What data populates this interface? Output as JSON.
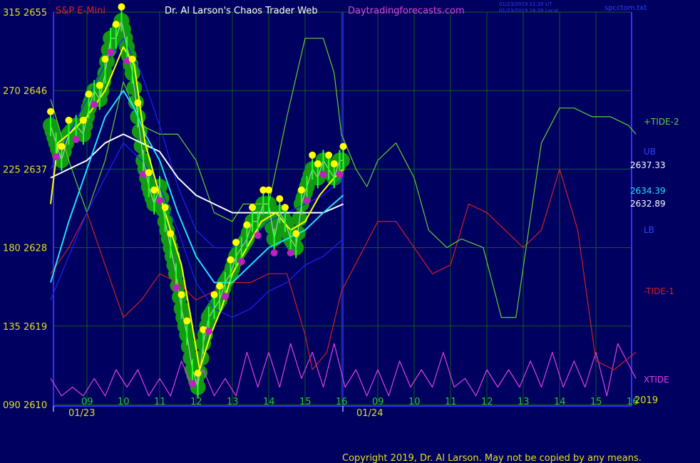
{
  "header": {
    "instrument": "S&P E-Mini",
    "title": "Dr. Al Larson's Chaos Trader Web",
    "site": "Daytradingforecasts.com",
    "stamp1": "01/23/2019 21:20 UT",
    "stamp2": "01/23/2019 16:20 Local",
    "file": "spcctom.txt"
  },
  "footer": {
    "copyright": "Copyright 2019, Dr. Al Larson. May not be copied by any means."
  },
  "colors": {
    "background": "#000060",
    "grid": "#0c5c22",
    "axis": "#3030ff",
    "price_bars": "#22ff22",
    "green_blob": "#139a13",
    "yellow_dot": "#ffff00",
    "magenta_dot": "#c020c0",
    "yellow_line": "#ffff00",
    "cyan_line": "#20e0ff",
    "white_line": "#ffffff",
    "blue_line": "#2020ff",
    "tide2": "#60d030",
    "tide1": "#d02020",
    "xtide": "#e040e0"
  },
  "chart_data": {
    "type": "line",
    "y_left_labels": [
      "315",
      "270",
      "225",
      "180",
      "135",
      "090"
    ],
    "y_right_labels": [
      "2655",
      "2646",
      "2637",
      "2628",
      "2619",
      "2610"
    ],
    "x_ticks_day1": [
      "09",
      "10",
      "11",
      "12",
      "13",
      "14",
      "15",
      "16"
    ],
    "x_ticks_day2": [
      "09",
      "10",
      "11",
      "12",
      "13",
      "14",
      "15",
      "16"
    ],
    "date1": "01/23",
    "date2": "01/24",
    "year": "2019",
    "ylim": [
      2610,
      2655
    ],
    "xlim": [
      8,
      17
    ],
    "legend": [
      {
        "label": "+TIDE-2",
        "color": "#60d030"
      },
      {
        "label": "UB",
        "color": "#2020ff"
      },
      {
        "label": "2637.33",
        "color": "#ffffff"
      },
      {
        "label": "2634.39",
        "color": "#20e0ff"
      },
      {
        "label": "2632.89",
        "color": "#ffffff"
      },
      {
        "label": "LB",
        "color": "#2020ff"
      },
      {
        "label": "-TIDE-1",
        "color": "#d02020"
      },
      {
        "label": "XTIDE",
        "color": "#e040e0"
      }
    ],
    "series": [
      {
        "id": "price",
        "x": [
          8.0,
          8.15,
          8.3,
          8.5,
          8.7,
          8.9,
          9.05,
          9.2,
          9.35,
          9.5,
          9.65,
          9.8,
          9.95,
          10.1,
          10.25,
          10.4,
          10.55,
          10.7,
          10.85,
          11.0,
          11.15,
          11.3,
          11.45,
          11.6,
          11.75,
          11.9,
          12.05,
          12.2,
          12.35,
          12.5,
          12.65,
          12.8,
          12.95,
          13.1,
          13.25,
          13.4,
          13.55,
          13.7,
          13.85,
          14.0,
          14.15,
          14.3,
          14.45,
          14.6,
          14.75,
          14.9,
          15.05,
          15.2,
          15.35,
          15.5,
          15.65,
          15.8,
          15.95,
          16.05
        ],
        "y": [
          2642,
          2640,
          2638,
          2641,
          2642,
          2641,
          2644,
          2646,
          2645,
          2648,
          2652,
          2652,
          2654,
          2651,
          2648,
          2643,
          2638,
          2635,
          2633,
          2635,
          2631,
          2628,
          2625,
          2621,
          2618,
          2614,
          2612,
          2617,
          2620,
          2621,
          2622,
          2624,
          2625,
          2627,
          2628,
          2629,
          2631,
          2631,
          2633,
          2633,
          2629,
          2632,
          2631,
          2629,
          2628,
          2633,
          2635,
          2637,
          2636,
          2638,
          2637,
          2636,
          2638,
          2638
        ]
      },
      {
        "id": "+TIDE-2",
        "x": [
          8.0,
          8.5,
          9.0,
          9.5,
          10.0,
          10.5,
          11.0,
          11.5,
          12.0,
          12.5,
          13.0,
          13.3,
          13.7,
          14.0,
          14.5,
          15.0,
          15.5,
          15.8,
          16.0,
          16.4,
          16.7,
          17.0,
          17.5,
          18.0,
          18.4,
          18.9,
          19.3,
          19.9,
          20.4,
          20.8,
          21.5,
          22.0,
          22.4,
          22.9,
          23.4,
          23.9,
          24.1
        ],
        "y": [
          2645,
          2638,
          2632,
          2638,
          2647,
          2642,
          2641,
          2641,
          2638,
          2632,
          2631,
          2633,
          2633,
          2633,
          2643,
          2652,
          2652,
          2648,
          2641,
          2637,
          2635,
          2638,
          2640,
          2636,
          2630,
          2628,
          2629,
          2628,
          2620,
          2620,
          2640,
          2644,
          2644,
          2643,
          2643,
          2642,
          2641
        ]
      },
      {
        "id": "-TIDE-1",
        "x": [
          8.0,
          8.5,
          9.0,
          9.5,
          10.0,
          10.5,
          11.0,
          11.5,
          12.0,
          12.5,
          13.0,
          13.5,
          14.0,
          14.5,
          15.0,
          15.2,
          15.6,
          16.0,
          16.5,
          17.0,
          17.5,
          18.0,
          18.5,
          19.0,
          19.5,
          20.0,
          20.5,
          21.0,
          21.5,
          22.0,
          22.5,
          23.0,
          23.5,
          24.1
        ],
        "y": [
          2625,
          2628,
          2632,
          2626,
          2620,
          2622,
          2625,
          2624,
          2622,
          2623,
          2624,
          2624,
          2625,
          2625,
          2618,
          2614,
          2616,
          2623,
          2627,
          2631,
          2631,
          2628,
          2625,
          2626,
          2633,
          2632,
          2630,
          2628,
          2630,
          2637,
          2630,
          2615,
          2614,
          2616
        ]
      },
      {
        "id": "XTIDE",
        "x": [
          8.0,
          8.3,
          8.6,
          8.9,
          9.2,
          9.5,
          9.8,
          10.1,
          10.4,
          10.7,
          11.0,
          11.3,
          11.6,
          11.9,
          12.2,
          12.5,
          12.8,
          13.1,
          13.4,
          13.7,
          14.0,
          14.3,
          14.6,
          14.9,
          15.2,
          15.5,
          15.8,
          16.1,
          16.4,
          16.7,
          17.0,
          17.3,
          17.6,
          17.9,
          18.2,
          18.5,
          18.8,
          19.1,
          19.4,
          19.7,
          20.0,
          20.3,
          20.6,
          20.9,
          21.2,
          21.5,
          21.8,
          22.1,
          22.4,
          22.7,
          23.0,
          23.3,
          23.6,
          24.1
        ],
        "y": [
          2613,
          2611,
          2612,
          2611,
          2613,
          2611,
          2614,
          2612,
          2614,
          2611,
          2613,
          2611,
          2615,
          2612,
          2614,
          2611,
          2613,
          2611,
          2616,
          2612,
          2616,
          2612,
          2617,
          2613,
          2616,
          2612,
          2617,
          2612,
          2614,
          2611,
          2614,
          2611,
          2615,
          2612,
          2614,
          2612,
          2616,
          2612,
          2613,
          2611,
          2614,
          2612,
          2614,
          2612,
          2615,
          2612,
          2616,
          2612,
          2615,
          2612,
          2616,
          2611,
          2617,
          2613
        ]
      },
      {
        "id": "yellow-ma",
        "x": [
          8.0,
          8.2,
          8.5,
          9.0,
          9.5,
          10.0,
          10.3,
          10.6,
          11.0,
          11.3,
          11.6,
          11.9,
          12.1,
          12.4,
          12.7,
          13.0,
          13.4,
          13.8,
          14.2,
          14.6,
          15.0,
          15.4,
          15.8,
          16.05
        ],
        "y": [
          2633,
          2640,
          2641,
          2643,
          2646,
          2651,
          2649,
          2640,
          2634,
          2630,
          2626,
          2619,
          2614,
          2618,
          2621,
          2625,
          2628,
          2631,
          2632,
          2630,
          2631,
          2634,
          2636,
          2637
        ]
      },
      {
        "id": "cyan-ma",
        "x": [
          8.0,
          8.5,
          9.0,
          9.5,
          10.0,
          10.3,
          10.6,
          11.0,
          11.5,
          12.0,
          12.5,
          13.0,
          13.5,
          14.0,
          14.5,
          15.0,
          15.5,
          16.05
        ],
        "y": [
          2624,
          2631,
          2637,
          2643,
          2646,
          2644,
          2641,
          2638,
          2632,
          2627,
          2624,
          2624,
          2626,
          2628,
          2629,
          2630,
          2632,
          2634
        ]
      },
      {
        "id": "white-ma",
        "x": [
          8.0,
          8.5,
          9.0,
          9.5,
          10.0,
          10.5,
          11.0,
          11.5,
          12.0,
          12.5,
          13.0,
          13.5,
          14.0,
          14.5,
          15.0,
          15.5,
          16.05
        ],
        "y": [
          2636,
          2637,
          2638,
          2640,
          2641,
          2640,
          2639,
          2636,
          2634,
          2633,
          2632,
          2632,
          2632,
          2632,
          2632,
          2632,
          2633
        ]
      },
      {
        "id": "UB",
        "x": [
          8.0,
          8.5,
          9.0,
          9.5,
          10.0,
          10.5,
          11.0,
          11.5,
          12.0,
          12.5,
          13.0,
          13.5,
          14.0,
          14.5,
          15.0,
          15.5,
          16.05
        ],
        "y": [
          2637,
          2641,
          2645,
          2649,
          2652,
          2648,
          2642,
          2635,
          2630,
          2628,
          2628,
          2629,
          2631,
          2632,
          2633,
          2634,
          2636
        ]
      },
      {
        "id": "LB",
        "x": [
          8.0,
          8.5,
          9.0,
          9.5,
          10.0,
          10.5,
          11.0,
          11.5,
          12.0,
          12.5,
          13.0,
          13.5,
          14.0,
          14.5,
          15.0,
          15.5,
          16.05
        ],
        "y": [
          2622,
          2627,
          2632,
          2636,
          2640,
          2638,
          2635,
          2630,
          2624,
          2621,
          2620,
          2621,
          2623,
          2624,
          2626,
          2627,
          2629
        ]
      }
    ]
  }
}
